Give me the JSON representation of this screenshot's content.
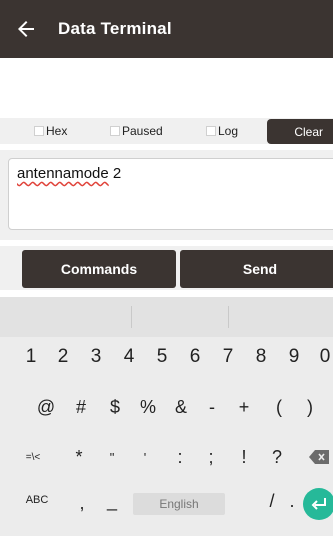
{
  "appbar": {
    "title": "Data Terminal"
  },
  "toolbar": {
    "hex": "Hex",
    "paused": "Paused",
    "log": "Log",
    "clear": "Clear"
  },
  "input": {
    "misspelled": "antennamode",
    "rest": " 2"
  },
  "actions": {
    "commands": "Commands",
    "send": "Send"
  },
  "keyboard": {
    "numbers": [
      "1",
      "2",
      "3",
      "4",
      "5",
      "6",
      "7",
      "8",
      "9",
      "0"
    ],
    "symbols1": [
      "@",
      "#",
      "$",
      "%",
      "&",
      "-",
      "+",
      "(",
      ")"
    ],
    "symbols2": [
      "=\\<",
      "*",
      "\"",
      "'",
      ":",
      ";",
      "!",
      "?"
    ],
    "bottom": {
      "abc": "ABC",
      "comma": ",",
      "underscore": "_",
      "space": "English",
      "slash": "/",
      "period": "."
    }
  },
  "colors": {
    "dark": "#3b3431",
    "accent": "#26b999",
    "error": "#e0433a"
  }
}
